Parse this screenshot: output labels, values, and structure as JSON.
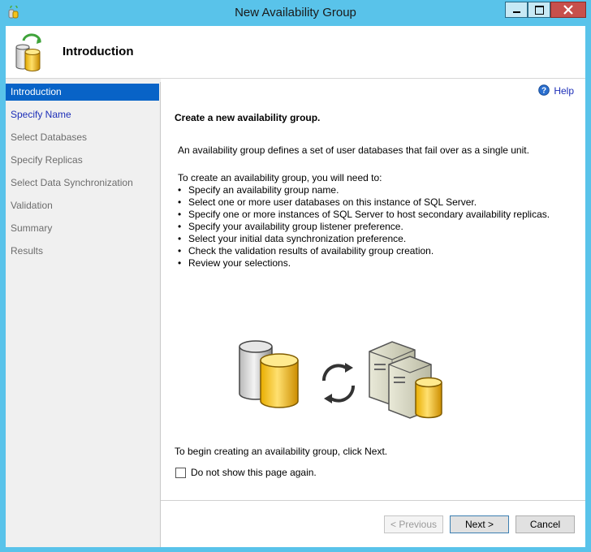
{
  "window": {
    "title": "New Availability Group",
    "controls": [
      "minimize-icon",
      "maximize-icon",
      "close-icon"
    ]
  },
  "header": {
    "title": "Introduction",
    "icon": "database-refresh-icon"
  },
  "sidebar": {
    "items": [
      {
        "label": "Introduction",
        "state": "active"
      },
      {
        "label": "Specify Name",
        "state": "link"
      },
      {
        "label": "Select Databases",
        "state": "disabled"
      },
      {
        "label": "Specify Replicas",
        "state": "disabled"
      },
      {
        "label": "Select Data Synchronization",
        "state": "disabled"
      },
      {
        "label": "Validation",
        "state": "disabled"
      },
      {
        "label": "Summary",
        "state": "disabled"
      },
      {
        "label": "Results",
        "state": "disabled"
      }
    ]
  },
  "main": {
    "help_label": "Help",
    "heading": "Create a new availability group.",
    "description": "An availability group defines a set of user databases that fail over as a single unit.",
    "intro": "To create an availability group, you will need to:",
    "bullets": [
      "Specify an availability group name.",
      "Select one or more user databases on this instance of SQL Server.",
      "Specify one or more instances of SQL Server to host secondary availability replicas.",
      "Specify your availability group listener preference.",
      "Select your initial data synchronization preference.",
      "Check the validation results of availability group creation.",
      "Review your selections."
    ],
    "begin_text": "To begin creating an availability group, click Next.",
    "checkbox_label": "Do not show this page again.",
    "checkbox_checked": false
  },
  "buttons": {
    "previous": "< Previous",
    "next": "Next >",
    "cancel": "Cancel"
  },
  "colors": {
    "titlebar": "#59c3ea",
    "selection": "#0863c7",
    "link": "#1d2fb8",
    "close": "#c7504c"
  }
}
